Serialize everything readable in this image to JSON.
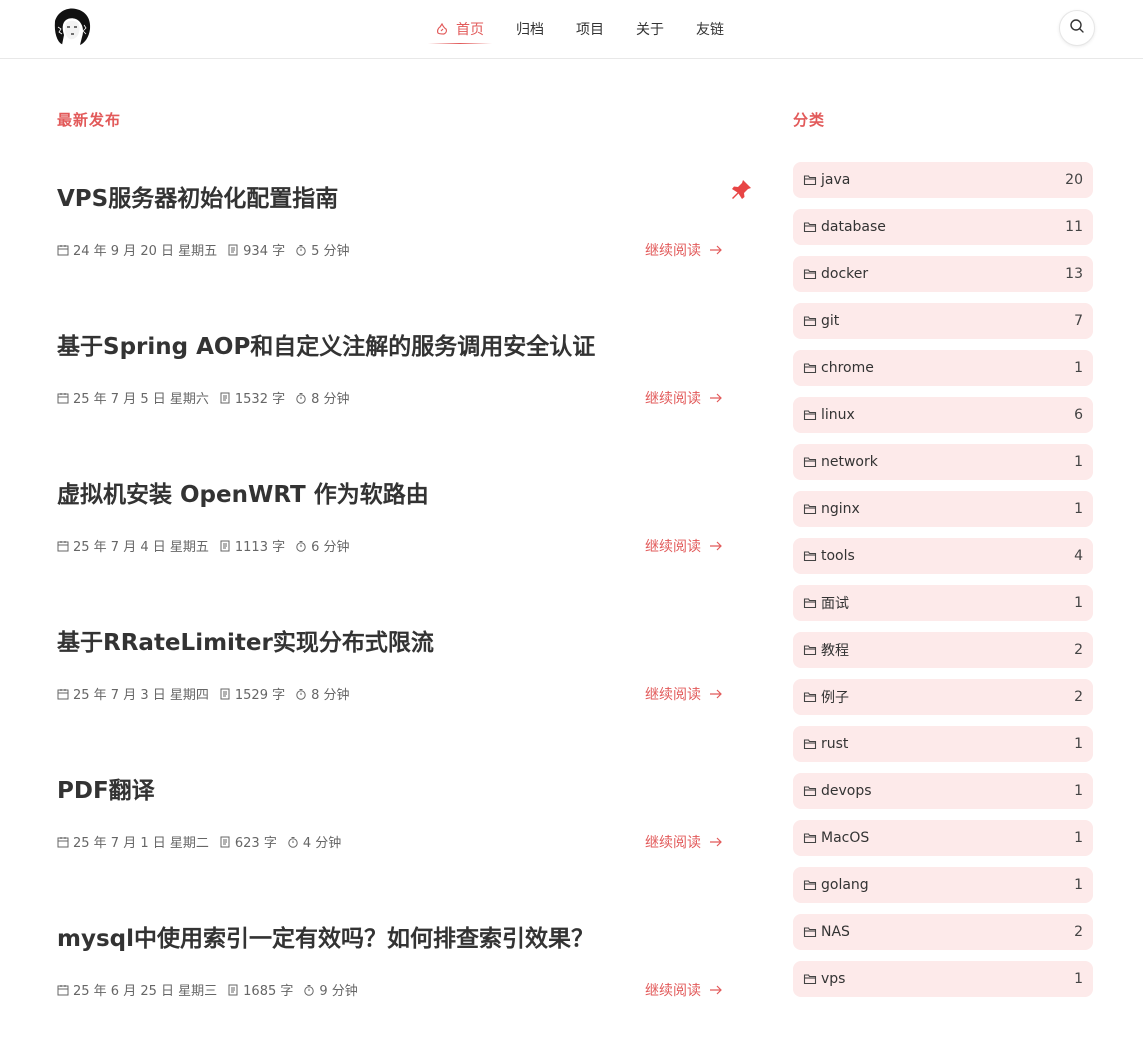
{
  "header": {
    "logo": "avatar-logo",
    "nav": [
      {
        "label": "首页",
        "icon": "home-icon",
        "active": true
      },
      {
        "label": "归档",
        "active": false
      },
      {
        "label": "项目",
        "active": false
      },
      {
        "label": "关于",
        "active": false
      },
      {
        "label": "友链",
        "active": false
      }
    ],
    "search_icon": "search-icon"
  },
  "main": {
    "section_title": "最新发布",
    "read_more_label": "继续阅读",
    "posts": [
      {
        "title": "VPS服务器初始化配置指南",
        "date": "24 年 9 月 20 日 星期五",
        "words": "934 字",
        "read_time": "5 分钟",
        "pinned": true
      },
      {
        "title": "基于Spring AOP和自定义注解的服务调用安全认证",
        "date": "25 年 7 月 5 日 星期六",
        "words": "1532 字",
        "read_time": "8 分钟",
        "pinned": false
      },
      {
        "title": "虚拟机安装 OpenWRT 作为软路由",
        "date": "25 年 7 月 4 日 星期五",
        "words": "1113 字",
        "read_time": "6 分钟",
        "pinned": false
      },
      {
        "title": "基于RRateLimiter实现分布式限流",
        "date": "25 年 7 月 3 日 星期四",
        "words": "1529 字",
        "read_time": "8 分钟",
        "pinned": false
      },
      {
        "title": "PDF翻译",
        "date": "25 年 7 月 1 日 星期二",
        "words": "623 字",
        "read_time": "4 分钟",
        "pinned": false
      },
      {
        "title": "mysql中使用索引一定有效吗？如何排查索引效果？",
        "date": "25 年 6 月 25 日 星期三",
        "words": "1685 字",
        "read_time": "9 分钟",
        "pinned": false
      }
    ]
  },
  "sidebar": {
    "title": "分类",
    "categories": [
      {
        "name": "java",
        "count": "20"
      },
      {
        "name": "database",
        "count": "11"
      },
      {
        "name": "docker",
        "count": "13"
      },
      {
        "name": "git",
        "count": "7"
      },
      {
        "name": "chrome",
        "count": "1"
      },
      {
        "name": "linux",
        "count": "6"
      },
      {
        "name": "network",
        "count": "1"
      },
      {
        "name": "nginx",
        "count": "1"
      },
      {
        "name": "tools",
        "count": "4"
      },
      {
        "name": "面试",
        "count": "1"
      },
      {
        "name": "教程",
        "count": "2"
      },
      {
        "name": "例子",
        "count": "2"
      },
      {
        "name": "rust",
        "count": "1"
      },
      {
        "name": "devops",
        "count": "1"
      },
      {
        "name": "MacOS",
        "count": "1"
      },
      {
        "name": "golang",
        "count": "1"
      },
      {
        "name": "NAS",
        "count": "2"
      },
      {
        "name": "vps",
        "count": "1"
      }
    ]
  },
  "colors": {
    "accent": "#e25a5a",
    "category_bg": "#fdeaea",
    "text": "#333333",
    "meta": "#666666"
  }
}
